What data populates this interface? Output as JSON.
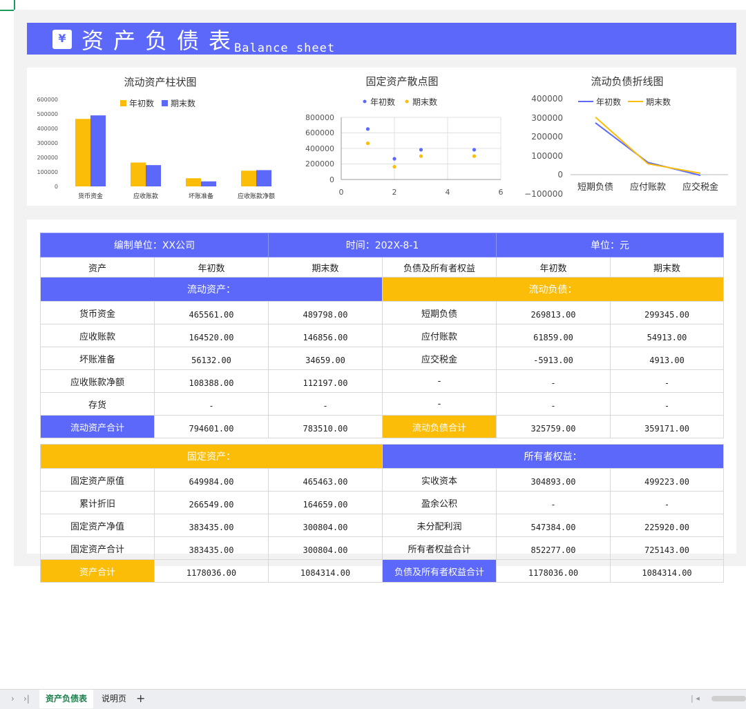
{
  "header": {
    "icon": "yen-icon",
    "icon_glyph": "¥",
    "title_cn": "资产负债表",
    "title_en": "Balance sheet"
  },
  "colors": {
    "accent_blue": "#5b68fa",
    "accent_yellow": "#fbbd07",
    "tab_green": "#1a7f4b"
  },
  "chart_data": [
    {
      "type": "bar",
      "title": "流动资产柱状图",
      "categories": [
        "货币资金",
        "应收账款",
        "坏账准备",
        "应收账款净额"
      ],
      "series": [
        {
          "name": "年初数",
          "values": [
            465561,
            164520,
            56132,
            108388
          ],
          "color": "#fbbd07"
        },
        {
          "name": "期末数",
          "values": [
            489798,
            146856,
            34659,
            112197
          ],
          "color": "#5b68fa"
        }
      ],
      "yticks": [
        "600000",
        "500000",
        "400000",
        "300000",
        "200000",
        "100000",
        "0"
      ],
      "ylim": [
        0,
        600000
      ],
      "legend": "top"
    },
    {
      "type": "scatter",
      "title": "固定资产散点图",
      "series": [
        {
          "name": "年初数",
          "x": [
            1,
            2,
            3,
            5
          ],
          "y": [
            649984,
            266549,
            383435,
            383435
          ],
          "color": "#5b68fa"
        },
        {
          "name": "期末数",
          "x": [
            1,
            2,
            3,
            5
          ],
          "y": [
            465463,
            164659,
            300804,
            300804
          ],
          "color": "#fbbd07"
        }
      ],
      "xticks": [
        "0",
        "2",
        "4",
        "6"
      ],
      "yticks": [
        "800000",
        "600000",
        "400000",
        "200000",
        "0"
      ],
      "xlim": [
        0,
        6
      ],
      "ylim": [
        0,
        800000
      ],
      "grid": true,
      "legend": "top"
    },
    {
      "type": "line",
      "title": "流动负债折线图",
      "categories": [
        "短期负债",
        "应付账款",
        "应交税金"
      ],
      "series": [
        {
          "name": "年初数",
          "values": [
            269813,
            61859,
            -5913
          ],
          "color": "#5b68fa"
        },
        {
          "name": "期末数",
          "values": [
            299345,
            54913,
            4913
          ],
          "color": "#fbbd07"
        }
      ],
      "yticks": [
        "400000",
        "300000",
        "200000",
        "100000",
        "0",
        "−100000"
      ],
      "ylim": [
        -100000,
        400000
      ],
      "legend": "top"
    }
  ],
  "table": {
    "unit_label": "编制单位：XX公司",
    "date_label": "时间：202X-8-1",
    "currency_label": "单位：元",
    "columns": [
      "资产",
      "年初数",
      "期末数",
      "负债及所有者权益",
      "年初数",
      "期末数"
    ],
    "sec_current_assets": "流动资产：",
    "sec_current_liabilities": "流动负债：",
    "current_rows": [
      [
        "货币资金",
        "465561.00",
        "489798.00",
        "短期负债",
        "269813.00",
        "299345.00"
      ],
      [
        "应收账款",
        "164520.00",
        "146856.00",
        "应付账款",
        "61859.00",
        "54913.00"
      ],
      [
        "坏账准备",
        "56132.00",
        "34659.00",
        "应交税金",
        "-5913.00",
        "4913.00"
      ],
      [
        "应收账款净额",
        "108388.00",
        "112197.00",
        "-",
        "-",
        "-"
      ],
      [
        "存货",
        "-",
        "-",
        "-",
        "-",
        "-"
      ]
    ],
    "current_total": [
      "流动资产合计",
      "794601.00",
      "783510.00",
      "流动负债合计",
      "325759.00",
      "359171.00"
    ],
    "sec_fixed_assets": "固定资产：",
    "sec_equity": "所有者权益：",
    "fixed_rows": [
      [
        "固定资产原值",
        "649984.00",
        "465463.00",
        "实收资本",
        "304893.00",
        "499223.00"
      ],
      [
        "累计折旧",
        "266549.00",
        "164659.00",
        "盈余公积",
        "-",
        "-"
      ],
      [
        "固定资产净值",
        "383435.00",
        "300804.00",
        "未分配利润",
        "547384.00",
        "225920.00"
      ],
      [
        "固定资产合计",
        "383435.00",
        "300804.00",
        "所有者权益合计",
        "852277.00",
        "725143.00"
      ]
    ],
    "grand_total": [
      "资产合计",
      "1178036.00",
      "1084314.00",
      "负债及所有者权益合计",
      "1178036.00",
      "1084314.00"
    ]
  },
  "tabs": {
    "nav_prev": "›",
    "nav_last": "›|",
    "items": [
      "资产负债表",
      "说明页"
    ],
    "add": "+"
  }
}
